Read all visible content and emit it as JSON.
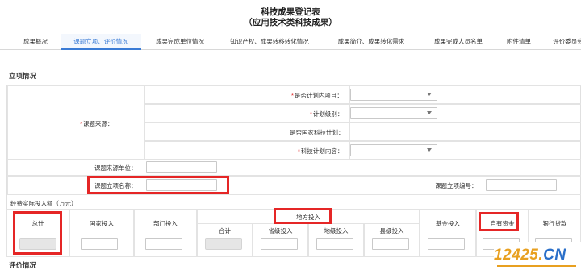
{
  "header": {
    "title": "科技成果登记表",
    "subtitle": "（应用技术类科技成果）"
  },
  "tabs": [
    {
      "label": "成果概况"
    },
    {
      "label": "课题立项、评价情况"
    },
    {
      "label": "成果完成单位情况"
    },
    {
      "label": "知识产权、成果转移转化情况"
    },
    {
      "label": "成果简介、成果转化需求"
    },
    {
      "label": "成果完成人员名单"
    },
    {
      "label": "附件清单"
    },
    {
      "label": "评价委员会"
    }
  ],
  "section_project": {
    "title": "立项情况",
    "project_source_label": "课题来源：",
    "is_planned_label": "是否计划内项目：",
    "plan_level_label": "计划级别：",
    "national_plan_label": "是否国家科技计划：",
    "plan_content_label": "科技计划内容：",
    "source_unit_label": "课题来源单位：",
    "project_name_label": "课题立项名称：",
    "project_number_label": "课题立项编号：",
    "investment_title": "经费实际投入额（万元）"
  },
  "investment": {
    "total": "总计",
    "national": "国家投入",
    "department": "部门投入",
    "local": "地方投入",
    "local_total": "合计",
    "provincial": "省级投入",
    "municipal": "地级投入",
    "county": "县级投入",
    "fund": "基金投入",
    "self_funded": "自有资金",
    "bank_loan": "银行贷款"
  },
  "section_evaluation": {
    "title": "评价情况"
  },
  "watermark": {
    "text_orange": "12425.",
    "text_blue": "CN"
  },
  "colors": {
    "accent": "#3a7bd5",
    "highlight_box": "#e52626",
    "required": "#e02020"
  }
}
